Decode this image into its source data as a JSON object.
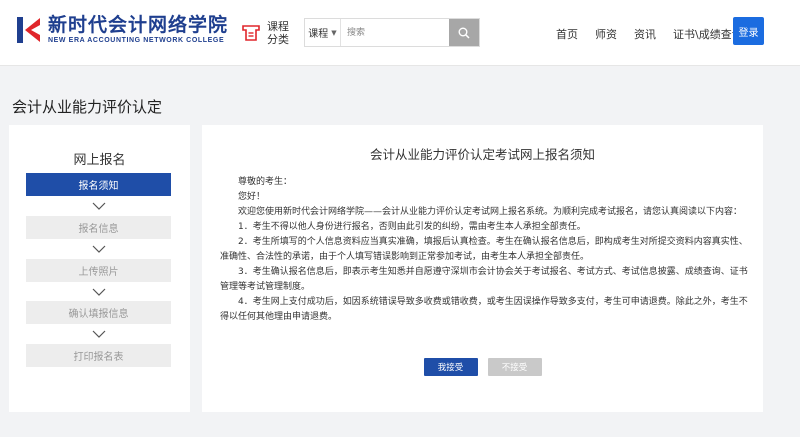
{
  "header": {
    "logo_cn": "新时代会计网络学院",
    "logo_en": "NEW ERA ACCOUNTING NETWORK COLLEGE",
    "category_label": "课程分类",
    "search": {
      "type_label": "课程",
      "placeholder": "搜索"
    },
    "nav": [
      "首页",
      "师资",
      "资讯",
      "证书\\成绩查询"
    ],
    "login_label": "登录"
  },
  "page_title": "会计从业能力评价认定",
  "sidebar": {
    "title": "网上报名",
    "steps": [
      "报名须知",
      "报名信息",
      "上传照片",
      "确认填报信息",
      "打印报名表"
    ]
  },
  "main": {
    "title": "会计从业能力评价认定考试网上报名须知",
    "greeting": "尊敬的考生：",
    "hello": "您好！",
    "intro": "欢迎您使用新时代会计网络学院——会计从业能力评价认定考试网上报名系统。为顺利完成考试报名，请您认真阅读以下内容：",
    "items": [
      "1．考生不得以他人身份进行报名，否则由此引发的纠纷，需由考生本人承担全部责任。",
      "2．考生所填写的个人信息资料应当真实准确，填报后认真检查。考生在确认报名信息后，即构成考生对所提交资料内容真实性、准确性、合法性的承诺，由于个人填写错误影响到正常参加考试，由考生本人承担全部责任。",
      "3．考生确认报名信息后，即表示考生知悉并自愿遵守深圳市会计协会关于考试报名、考试方式、考试信息披露、成绩查询、证书管理等考试管理制度。",
      "4．考生网上支付成功后，如因系统错误导致多收费或错收费，或考生因误操作导致多支付，考生可申请退费。除此之外，考生不得以任何其他理由申请退费。"
    ],
    "accept_label": "我接受",
    "decline_label": "不接受"
  },
  "colors": {
    "primary": "#1f4ea8",
    "login": "#1b6ce0",
    "logo_red": "#e0262b"
  }
}
